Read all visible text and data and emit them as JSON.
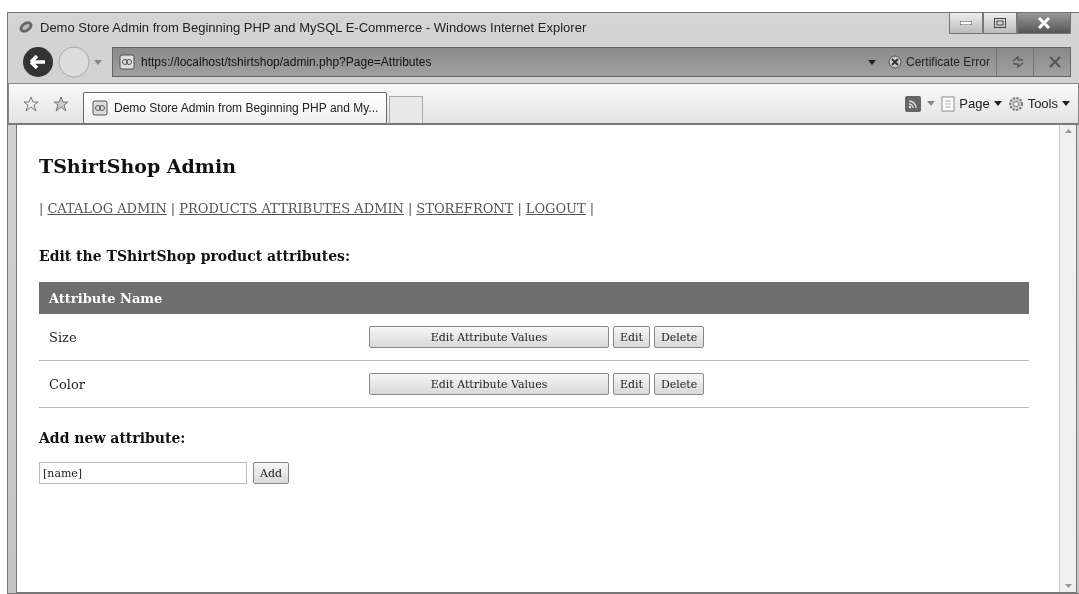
{
  "window": {
    "title": "Demo Store Admin from Beginning PHP and MySQL E-Commerce - Windows Internet Explorer"
  },
  "address_bar": {
    "url": "https://localhost/tshirtshop/admin.php?Page=Attributes",
    "certificate_error": "Certificate Error"
  },
  "tabs": [
    {
      "label": "Demo Store Admin from Beginning PHP and My...",
      "selected": true
    }
  ],
  "command_bar": {
    "page_menu": "Page",
    "tools_menu": "Tools"
  },
  "page": {
    "heading": "TShirtShop Admin",
    "nav": [
      {
        "kind": "separator",
        "text": "|"
      },
      {
        "kind": "link",
        "text": "CATALOG ADMIN"
      },
      {
        "kind": "separator",
        "text": "|"
      },
      {
        "kind": "link",
        "text": "PRODUCTS ATTRIBUTES ADMIN"
      },
      {
        "kind": "separator",
        "text": "|"
      },
      {
        "kind": "link",
        "text": "STOREFRONT"
      },
      {
        "kind": "separator",
        "text": "|"
      },
      {
        "kind": "link",
        "text": "LOGOUT"
      },
      {
        "kind": "separator",
        "text": "|"
      }
    ],
    "section_title": "Edit the TShirtShop product attributes:",
    "table": {
      "columns": [
        "Attribute Name"
      ],
      "rows": [
        {
          "name": "Size",
          "buttons": [
            "Edit Attribute Values",
            "Edit",
            "Delete"
          ]
        },
        {
          "name": "Color",
          "buttons": [
            "Edit Attribute Values",
            "Edit",
            "Delete"
          ]
        }
      ]
    },
    "add_title": "Add new attribute:",
    "add_field": {
      "value": "[name]"
    },
    "add_button": "Add"
  }
}
